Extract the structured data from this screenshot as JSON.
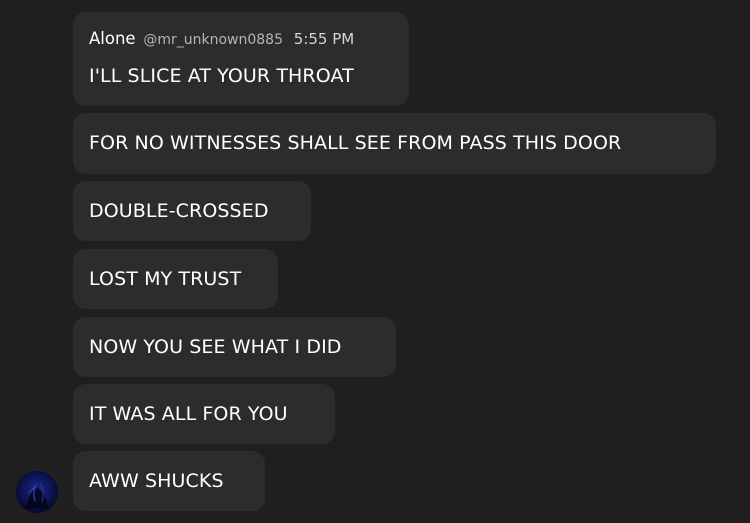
{
  "message_group": {
    "author": "Alone",
    "handle": "@mr_unknown0885",
    "time": "5:55 PM",
    "messages": [
      "I'LL SLICE AT YOUR THROAT",
      "FOR NO WITNESSES SHALL SEE FROM PASS THIS DOOR",
      "DOUBLE-CROSSED",
      "LOST MY TRUST",
      "NOW YOU SEE WHAT I DID",
      "IT WAS ALL FOR YOU",
      "AWW SHUCKS"
    ]
  },
  "colors": {
    "background": "#1f1f1f",
    "bubble": "#2c2c2c",
    "text": "#ffffff",
    "handle": "#b5b5b5",
    "avatar": "#0b0b3a"
  }
}
